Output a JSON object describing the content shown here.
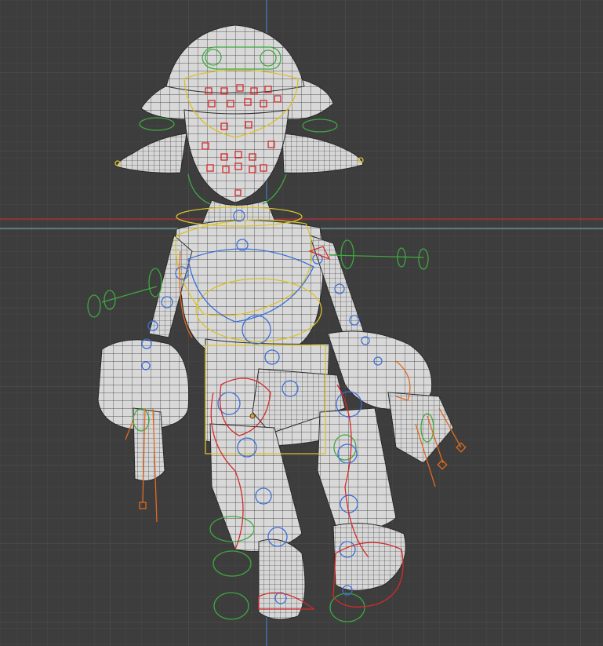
{
  "viewport": {
    "background_color": "#3d3d3d",
    "grid_minor_color": "#474747",
    "grid_major_color": "#525252",
    "axis_x_color": "#b5303c",
    "axis_y_color": "#4d78c4",
    "horizon_line_color": "#6fb6c4"
  },
  "model": {
    "mesh_fill_color": "#dcdcdc",
    "mesh_wire_color": "#2a2a2a",
    "rig_colors": {
      "control_green": "#3ea83e",
      "control_yellow": "#d9c02a",
      "control_blue": "#3a6fd8",
      "control_red": "#d42a2a",
      "control_orange": "#e06a20"
    }
  }
}
